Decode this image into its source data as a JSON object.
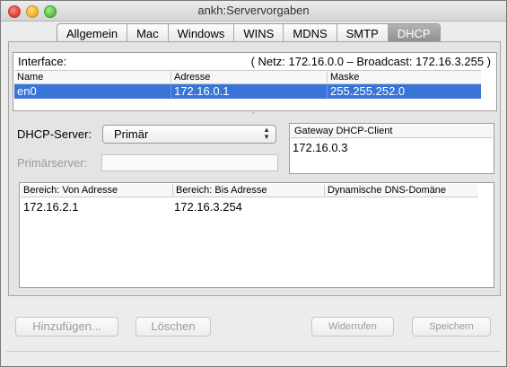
{
  "window": {
    "title": "ankh:Servervorgaben"
  },
  "tabs": [
    "Allgemein",
    "Mac",
    "Windows",
    "WINS",
    "MDNS",
    "SMTP",
    "DHCP"
  ],
  "active_tab": "DHCP",
  "interface": {
    "label": "Interface:",
    "network_info": "( Netz: 172.16.0.0 – Broadcast: 172.16.3.255 )",
    "columns": [
      "Name",
      "Adresse",
      "Maske"
    ],
    "rows": [
      {
        "name": "en0",
        "address": "172.16.0.1",
        "mask": "255.255.252.0",
        "selected": true
      }
    ]
  },
  "dhcp": {
    "server_label": "DHCP-Server:",
    "server_value": "Primär",
    "primary_label": "Primärserver:",
    "primary_value": ""
  },
  "gateway": {
    "header": "Gateway DHCP-Client",
    "value": "172.16.0.3"
  },
  "ranges": {
    "columns": [
      "Bereich:  Von Adresse",
      "Bereich:  Bis Adresse",
      "Dynamische DNS-Domäne"
    ],
    "rows": [
      {
        "from": "172.16.2.1",
        "to": "172.16.3.254",
        "dns": ""
      }
    ]
  },
  "buttons": {
    "add": "Hinzufügen...",
    "delete": "Löschen",
    "revert": "Widerrufen",
    "save": "Speichern"
  },
  "colors": {
    "selection": "#3875d7",
    "active_tab": "#9a9a9a"
  }
}
